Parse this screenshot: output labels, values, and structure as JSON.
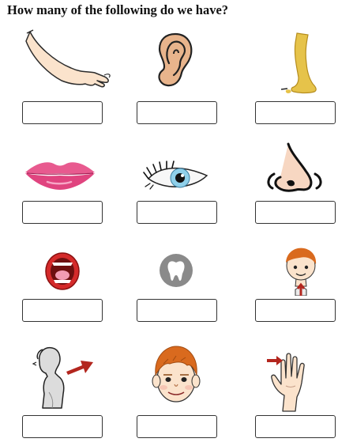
{
  "worksheet": {
    "question": "How many of the following do we have?",
    "answers": {
      "arm": "",
      "ear": "",
      "leg": "",
      "lips": "",
      "eye": "",
      "nose": "",
      "mouth": "",
      "tooth": "",
      "neck": "",
      "shoulder": "",
      "head": "",
      "finger": ""
    }
  },
  "colors": {
    "skin": "#fbe3cc",
    "outline": "#2b2b2b",
    "arrow": "#b3261e",
    "lips": "#e85a8f",
    "hair": "#d96a1e",
    "eye_iris": "#8fd0ea",
    "tooth_bg": "#8a8a8a",
    "leg": "#e6c34a"
  },
  "icons": [
    "arm-icon",
    "ear-icon",
    "leg-icon",
    "lips-icon",
    "eye-icon",
    "nose-icon",
    "mouth-icon",
    "tooth-icon",
    "neck-boy-icon",
    "shoulder-icon",
    "head-icon",
    "hand-finger-icon"
  ]
}
